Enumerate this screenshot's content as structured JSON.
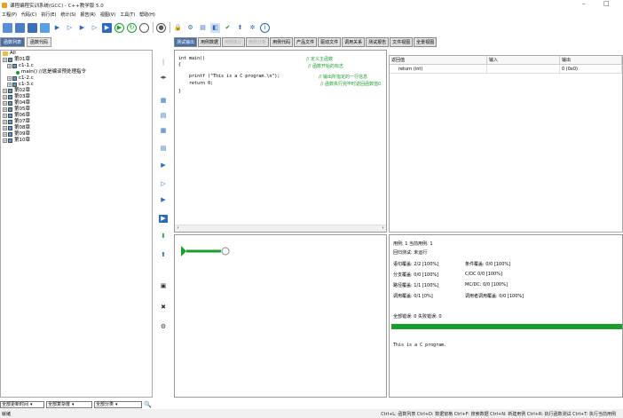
{
  "window": {
    "title": "课程编程实训系统(GCC) - C++教学版 5.0",
    "controls": [
      "–",
      "□"
    ]
  },
  "menu": [
    "工程(P)",
    "代码(C)",
    "执行(E)",
    "统计(S)",
    "报告(R)",
    "视图(V)",
    "工具(T)",
    "帮助(H)"
  ],
  "left_tabs": [
    "函数列表",
    "函数代码"
  ],
  "tree": [
    {
      "indent": 0,
      "kind": "folder",
      "label": "All"
    },
    {
      "indent": 0,
      "kind": "exp",
      "label": "第01章"
    },
    {
      "indent": 1,
      "kind": "file",
      "label": "c1-1.c"
    },
    {
      "indent": 3,
      "kind": "dot",
      "label": "main() //这是编译预处理指令"
    },
    {
      "indent": 1,
      "kind": "file",
      "label": "c1-2.c"
    },
    {
      "indent": 1,
      "kind": "file",
      "label": "c1-3.c"
    },
    {
      "indent": 0,
      "kind": "exp",
      "label": "第02章"
    },
    {
      "indent": 0,
      "kind": "exp",
      "label": "第03章"
    },
    {
      "indent": 0,
      "kind": "exp",
      "label": "第04章"
    },
    {
      "indent": 0,
      "kind": "exp",
      "label": "第05章"
    },
    {
      "indent": 0,
      "kind": "exp",
      "label": "第06章"
    },
    {
      "indent": 0,
      "kind": "exp",
      "label": "第07章"
    },
    {
      "indent": 0,
      "kind": "exp",
      "label": "第08章"
    },
    {
      "indent": 0,
      "kind": "exp",
      "label": "第09章"
    },
    {
      "indent": 0,
      "kind": "exp",
      "label": "第10章"
    }
  ],
  "filters": [
    "全部更新时间",
    "全部复杂度",
    "全部分类"
  ],
  "main_tabs": [
    {
      "label": "测试输出",
      "state": "active"
    },
    {
      "label": "用例数据",
      "state": "normal"
    },
    {
      "label": "用例执行",
      "state": "disabled"
    },
    {
      "label": "用例分析",
      "state": "disabled"
    },
    {
      "label": "用例代码",
      "state": "normal"
    },
    {
      "label": "产品文件",
      "state": "normal"
    },
    {
      "label": "驱动文件",
      "state": "normal"
    },
    {
      "label": "调用关系",
      "state": "normal"
    },
    {
      "label": "测试报告",
      "state": "normal"
    },
    {
      "label": "文件视图",
      "state": "normal"
    },
    {
      "label": "全景视图",
      "state": "normal"
    }
  ],
  "code": {
    "lines": [
      "int main()",
      "{",
      "    printf (\"This is a C program.\\n\");",
      "    return 0;",
      "}"
    ],
    "comments": [
      "// 定义主函数",
      "// 函数开始的标志",
      "// 输出所指定的一行信息",
      "// 函数执行完毕时返回函数值0"
    ]
  },
  "params": {
    "headers": [
      "返回值",
      "输入",
      "输出"
    ],
    "row": [
      "return (int)",
      "",
      "0 (0x0)"
    ]
  },
  "results": {
    "case_count": "用例: 1  当前用例: 1",
    "regression": "回归测试: 未运行",
    "coverage": [
      [
        "语句覆盖: 2/2 [100%]",
        "条件覆盖: 0/0 [100%]"
      ],
      [
        "分支覆盖: 0/0 [100%]",
        "C/DC  0/0 [100%]"
      ],
      [
        "路径覆盖: 1/1 [100%]",
        "MC/DC: 0/0 [100%]"
      ],
      [
        "调用覆盖: 0/1 [0%]",
        "调用者调用覆盖: 0/0 [100%]"
      ]
    ],
    "errors": "全部错误: 0  失败错误: 0",
    "output": "This is a C program."
  },
  "status": {
    "left": "就绪",
    "right": "Ctrl+L: 函数列表  Ctrl+D: 数据窗格  Ctrl+F: 搜索数据  Ctrl+N: 新建用例 Ctrl+R: 执行函数测试  Ctrl+T: 执行当前用例"
  },
  "colors": {
    "accent": "#4a6fa5",
    "green": "#1a9e2a",
    "blue": "#2a6bc0"
  }
}
